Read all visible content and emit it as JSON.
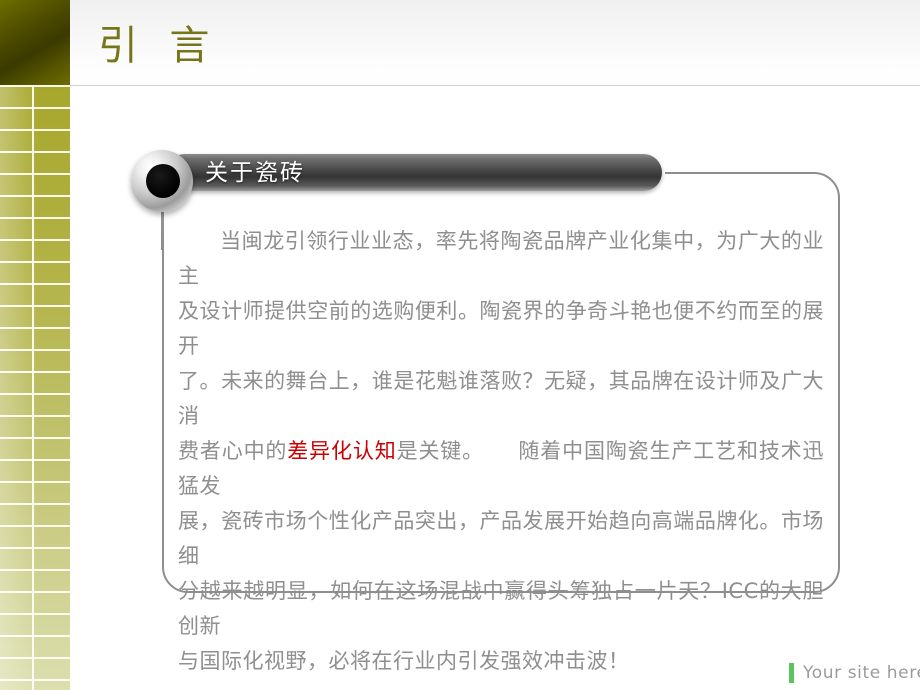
{
  "slide": {
    "title": "引  言",
    "title_color": "#77751a",
    "background_color": "#ffffff"
  },
  "sidebar": {
    "name": "decorative-grid-sidebar",
    "top_block_color": "#4a4900",
    "grid_color_top": "#a7a72c",
    "grid_color_bottom": "#dcdfae"
  },
  "banner": {
    "label": "关于瓷砖",
    "label_color": "#ffffff",
    "fill_color": "#4a4a4a",
    "bullet_color": "#000000"
  },
  "content": {
    "lines": [
      {
        "segments": [
          {
            "type": "indent"
          },
          {
            "type": "text",
            "text": "当闽龙引领行业业态，率先将陶瓷品牌产业化集中，为广大的业主"
          }
        ]
      },
      {
        "segments": [
          {
            "type": "text",
            "text": "及设计师提供空前的选购便利。陶瓷界的争奇斗艳也便不约而至的展开"
          }
        ]
      },
      {
        "segments": [
          {
            "type": "text",
            "text": "了。未来的舞台上，谁是花魁谁落败？无疑，其品牌在设计师及广大消"
          }
        ]
      },
      {
        "segments": [
          {
            "type": "text",
            "text": "费者心中的"
          },
          {
            "type": "highlight",
            "text": "差异化认知"
          },
          {
            "type": "text",
            "text": "是关键。"
          },
          {
            "type": "gap"
          },
          {
            "type": "text",
            "text": "随着中国陶瓷生产工艺和技术迅猛发"
          }
        ]
      },
      {
        "segments": [
          {
            "type": "text",
            "text": "展，瓷砖市场个性化产品突出，产品发展开始趋向高端品牌化。市场细"
          }
        ]
      },
      {
        "segments": [
          {
            "type": "text",
            "text": "分越来越明显，如何在这场混战中赢得头筹独占一片天？ICC的大胆创新"
          }
        ]
      },
      {
        "segments": [
          {
            "type": "text",
            "text": "与国际化视野，必将在行业内引发强效冲击波！"
          }
        ]
      }
    ],
    "text_color": "#8f8f8f",
    "highlight_color": "#cc0000"
  },
  "footer": {
    "label": "Your site here",
    "accent_color": "#5cc45c",
    "text_color": "#9b9b9b"
  }
}
